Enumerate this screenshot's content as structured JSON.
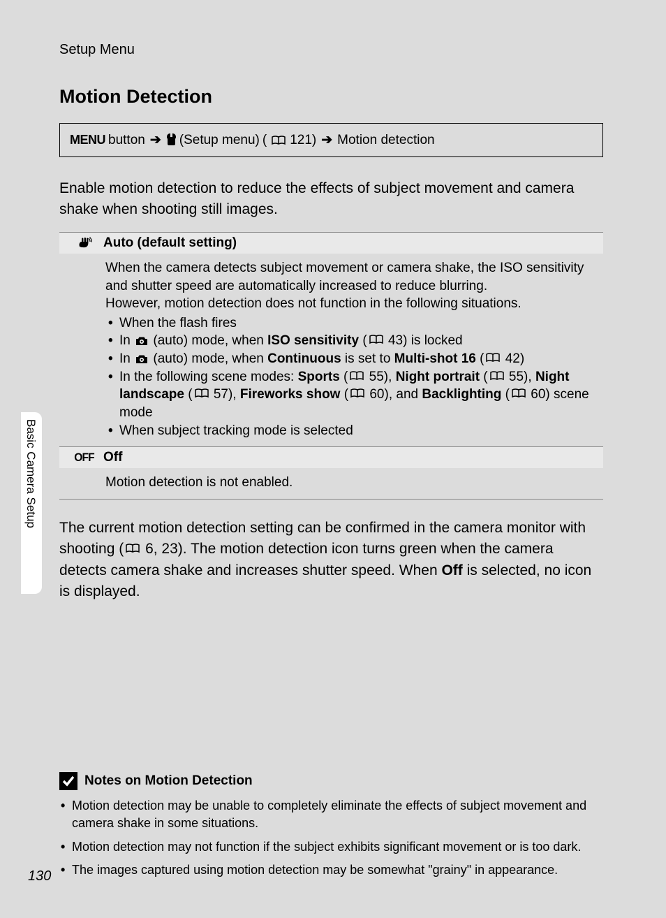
{
  "section_label": "Setup Menu",
  "title": "Motion Detection",
  "breadcrumb": {
    "menu_word": "MENU",
    "button_word": "button",
    "setup_menu": "(Setup menu)",
    "ref_121": "121)",
    "target": "Motion detection"
  },
  "intro": "Enable motion detection to reduce the effects of subject movement and camera shake when shooting still images.",
  "options": {
    "auto": {
      "label": "Auto (default setting)",
      "desc1": "When the camera detects subject movement or camera shake, the ISO sensitivity and shutter speed are automatically increased to reduce blurring.",
      "desc2": "However, motion detection does not function in the following situations.",
      "bullets": {
        "b1": "When the flash fires",
        "b2_pre": "In ",
        "b2_mid": " (auto) mode, when ",
        "b2_bold": "ISO sensitivity",
        "b2_paren": " (",
        "b2_ref": " 43) is locked",
        "b3_pre": "In ",
        "b3_mid": " (auto) mode, when ",
        "b3_bold1": "Continuous",
        "b3_mid2": " is set to ",
        "b3_bold2": "Multi-shot 16",
        "b3_paren": " (",
        "b3_ref": " 42)",
        "b4_pre": "In the following scene modes: ",
        "b4_sports": "Sports",
        "b4_paren1": " (",
        "b4_ref1": " 55), ",
        "b4_night_portrait": "Night portrait",
        "b4_paren2": " (",
        "b4_ref2": " 55), ",
        "b4_night_landscape": "Night landscape",
        "b4_paren3": " (",
        "b4_ref3": " 57), ",
        "b4_fireworks": "Fireworks show",
        "b4_paren4": " (",
        "b4_ref4": " 60), and ",
        "b4_backlighting": "Backlighting",
        "b4_paren5": " (",
        "b4_ref5": " 60) scene mode",
        "b5": "When subject tracking mode is selected"
      }
    },
    "off": {
      "icon_text": "OFF",
      "label": "Off",
      "desc": "Motion detection is not enabled."
    }
  },
  "after_table": {
    "t1": "The current motion detection setting can be confirmed in the camera monitor with shooting (",
    "t_ref": " 6, 23). The motion detection icon turns green when the camera detects camera shake and increases shutter speed. When ",
    "t_off": "Off",
    "t2": " is selected, no icon is displayed."
  },
  "notes": {
    "title": "Notes on Motion Detection",
    "items": [
      "Motion detection may be unable to completely eliminate the effects of subject movement and camera shake in some situations.",
      "Motion detection may not function if the subject exhibits significant movement or is too dark.",
      "The images captured using motion detection may be somewhat \"grainy\" in appearance."
    ]
  },
  "side_tab": "Basic Camera Setup",
  "page_number": "130"
}
